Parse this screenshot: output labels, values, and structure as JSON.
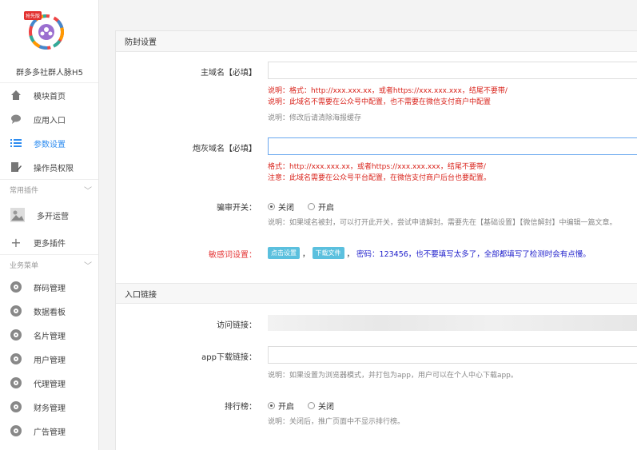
{
  "sidebar": {
    "app_name": "群多多社群人脉H5",
    "logo_badge": "抢先版",
    "items": [
      {
        "label": "模块首页",
        "icon": "home-icon"
      },
      {
        "label": "应用入口",
        "icon": "chat-icon"
      },
      {
        "label": "参数设置",
        "icon": "list-icon",
        "active": true
      },
      {
        "label": "操作员权限",
        "icon": "edit-doc-icon"
      }
    ],
    "plugins_title": "常用插件",
    "plugins": [
      {
        "label": "多开运营",
        "icon": "image-icon"
      },
      {
        "label": "更多插件",
        "icon": "plus-icon"
      }
    ],
    "business_title": "业务菜单",
    "business": [
      {
        "label": "群码管理",
        "icon": "gear-icon"
      },
      {
        "label": "数据看板",
        "icon": "gear-icon"
      },
      {
        "label": "名片管理",
        "icon": "gear-icon"
      },
      {
        "label": "用户管理",
        "icon": "gear-icon"
      },
      {
        "label": "代理管理",
        "icon": "gear-icon"
      },
      {
        "label": "财务管理",
        "icon": "gear-icon"
      },
      {
        "label": "广告管理",
        "icon": "gear-icon"
      }
    ]
  },
  "section1": {
    "title": "防封设置",
    "main_domain": {
      "label": "主域名【必填】",
      "value": "",
      "hint1": "说明：格式：http://xxx.xxx.xx，或者https://xxx.xxx.xxx，结尾不要带/",
      "hint2": "说明：此域名不需要在公众号中配置，也不需要在微信支付商户中配置",
      "hint3": "说明：修改后请清除海报缓存"
    },
    "gray_domain": {
      "label": "炮灰域名【必填】",
      "value": "",
      "hint1": "格式：http://xxx.xxx.xx，或者https://xxx.xxx.xxx，结尾不要带/",
      "hint2": "注意：此域名需要在公众号平台配置，在微信支付商户后台也要配置。"
    },
    "review_switch": {
      "label": "骗审开关：",
      "off": "关闭",
      "on": "开启",
      "selected": "off",
      "hint": "说明：如果域名被封，可以打开此开关，尝试申请解封。需要先在【基础设置】【微信解封】中编辑一篇文章。"
    },
    "sensitive": {
      "label": "敏感词设置：",
      "btn_setting": "点击设置",
      "btn_download": "下载文件",
      "text": "密码：123456，也不要填写太多了，全部都填写了检测时会有点慢。",
      "separator": "，"
    }
  },
  "section2": {
    "title": "入口链接",
    "visit_link": {
      "label": "访问链接："
    },
    "app_link": {
      "label": "app下载链接：",
      "value": "",
      "hint": "说明：如果设置为浏览器模式，并打包为app，用户可以在个人中心下载app。"
    },
    "ranking": {
      "label": "排行榜：",
      "on": "开启",
      "off": "关闭",
      "selected": "on",
      "hint": "说明：关闭后，推广页面中不显示排行榜。"
    }
  }
}
